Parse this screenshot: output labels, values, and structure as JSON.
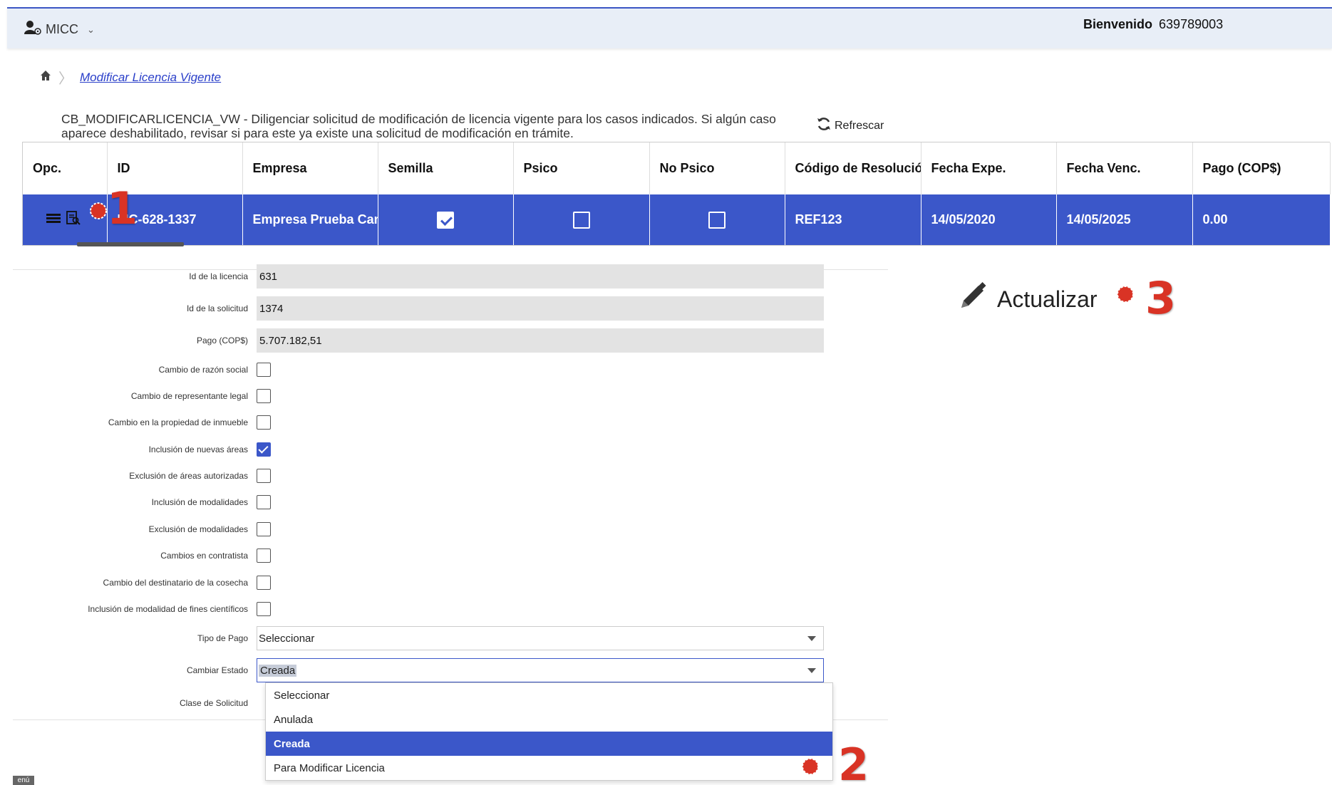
{
  "topbar": {
    "user_label": "MICC",
    "welcome_label": "Bienvenido",
    "user_id": "639789003"
  },
  "breadcrumb": {
    "current": "Modificar Licencia Vigente"
  },
  "description": "CB_MODIFICARLICENCIA_VW - Diligenciar solicitud de modificación de licencia vigente para los casos indicados. Si algún caso aparece deshabilitado, revisar si para este ya existe una solicitud de modificación en trámite.",
  "refresh_label": "Refrescar",
  "table": {
    "columns": [
      "Opc.",
      "ID",
      "Empresa",
      "Semilla",
      "Psico",
      "No Psico",
      "Código de Resolución",
      "Fecha Expe.",
      "Fecha Venc.",
      "Pago (COP$)"
    ],
    "row": {
      "id": "LIC-628-1337",
      "empresa": "Empresa Prueba Canr",
      "semilla": true,
      "psico": false,
      "no_psico": false,
      "codigo": "REF123",
      "fecha_expe": "14/05/2020",
      "fecha_venc": "14/05/2025",
      "pago": "0.00"
    }
  },
  "form": {
    "id_licencia_label": "Id de la licencia",
    "id_licencia": "631",
    "id_solicitud_label": "Id de la solicitud",
    "id_solicitud": "1374",
    "pago_label": "Pago (COP$)",
    "pago": "5.707.182,51",
    "checks": [
      {
        "label": "Cambio de razón social",
        "checked": false
      },
      {
        "label": "Cambio de representante legal",
        "checked": false
      },
      {
        "label": "Cambio en la propiedad de inmueble",
        "checked": false
      },
      {
        "label": "Inclusión de nuevas áreas",
        "checked": true
      },
      {
        "label": "Exclusión de áreas autorizadas",
        "checked": false
      },
      {
        "label": "Inclusión de modalidades",
        "checked": false
      },
      {
        "label": "Exclusión de modalidades",
        "checked": false
      },
      {
        "label": "Cambios en contratista",
        "checked": false
      },
      {
        "label": "Cambio del destinatario de la cosecha",
        "checked": false
      },
      {
        "label": "Inclusión de modalidad de fines científicos",
        "checked": false
      }
    ],
    "tipo_pago_label": "Tipo de Pago",
    "tipo_pago_value": "Seleccionar",
    "cambiar_estado_label": "Cambiar Estado",
    "cambiar_estado_value": "Creada",
    "clase_solicitud_label": "Clase de Solicitud"
  },
  "dropdown_options": [
    "Seleccionar",
    "Anulada",
    "Creada",
    "Para Modificar Licencia"
  ],
  "dropdown_active_index": 2,
  "update_label": "Actualizar",
  "markers": {
    "m1": "1",
    "m2": "2",
    "m3": "3"
  },
  "menu_tab": "enú",
  "colors": {
    "accent": "#3b57c9",
    "marker": "#d93325",
    "topbar": "#e8eef7"
  }
}
